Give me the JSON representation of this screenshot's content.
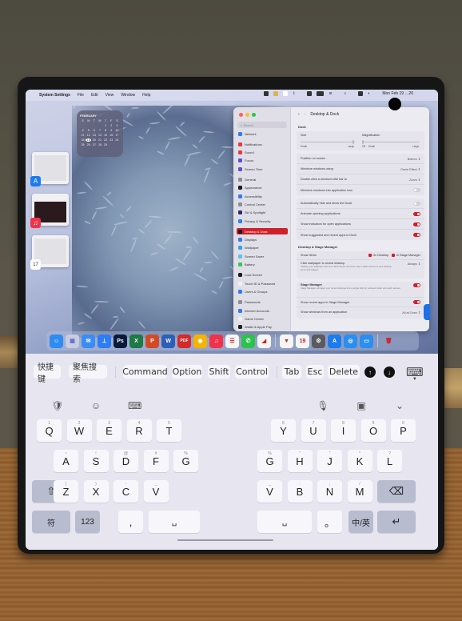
{
  "mac": {
    "menubar": {
      "apple_icon": "apple-icon",
      "app": "System Settings",
      "items": [
        "File",
        "Edit",
        "View",
        "Window",
        "Help"
      ],
      "clock": "Mon Feb 19 …26"
    },
    "calendar_widget": {
      "month": "FEBRUARY",
      "weekdays": [
        "S",
        "M",
        "T",
        "W",
        "T",
        "F",
        "S"
      ],
      "days": [
        "",
        "",
        "",
        "",
        "1",
        "2",
        "3",
        "4",
        "5",
        "6",
        "7",
        "8",
        "9",
        "10",
        "11",
        "12",
        "13",
        "14",
        "15",
        "16",
        "17",
        "18",
        "19",
        "20",
        "21",
        "22",
        "23",
        "24",
        "25",
        "26",
        "27",
        "28",
        "29"
      ],
      "today": "19"
    },
    "stage_manager": [
      {
        "app": "App Store",
        "icon": "app-store-icon",
        "color": "#1a7cf0",
        "glyph": "A"
      },
      {
        "app": "Music",
        "icon": "music-icon",
        "color": "#f0324a",
        "glyph": "♫"
      },
      {
        "app": "Calendar",
        "icon": "calendar-icon",
        "color": "#ffffff",
        "glyph": "17"
      }
    ],
    "settings": {
      "search_placeholder": "Search",
      "sidebar": [
        {
          "label": "Network",
          "color": "#2e7cf6"
        },
        {
          "label": "Notifications",
          "color": "#e8383d"
        },
        {
          "label": "Sound",
          "color": "#e8383d"
        },
        {
          "label": "Focus",
          "color": "#5b4fd6"
        },
        {
          "label": "Screen Time",
          "color": "#5b4fd6"
        },
        {
          "label": "General",
          "color": "#8e8e93"
        },
        {
          "label": "Appearance",
          "color": "#1c1c1e"
        },
        {
          "label": "Accessibility",
          "color": "#2e7cf6"
        },
        {
          "label": "Control Center",
          "color": "#8e8e93"
        },
        {
          "label": "Siri & Spotlight",
          "color": "#2a2a6e"
        },
        {
          "label": "Privacy & Security",
          "color": "#2e7cf6"
        },
        {
          "label": "Desktop & Dock",
          "color": "#1c1c1e",
          "selected": true
        },
        {
          "label": "Displays",
          "color": "#2e7cf6"
        },
        {
          "label": "Wallpaper",
          "color": "#33a4e8"
        },
        {
          "label": "Screen Saver",
          "color": "#5fc0e8"
        },
        {
          "label": "Battery",
          "color": "#34c759"
        },
        {
          "label": "Lock Screen",
          "color": "#1c1c1e"
        },
        {
          "label": "Touch ID & Password",
          "color": "#f0f0f0"
        },
        {
          "label": "Users & Groups",
          "color": "#2e7cf6"
        },
        {
          "label": "Passwords",
          "color": "#8e8e93"
        },
        {
          "label": "Internet Accounts",
          "color": "#2e7cf6"
        },
        {
          "label": "Game Center",
          "color": "#f0f0f0"
        },
        {
          "label": "Wallet & Apple Pay",
          "color": "#1c1c1e"
        }
      ],
      "page_title": "Desktop & Dock",
      "dock_section": "Dock",
      "size_label": "Size",
      "size_min": "Small",
      "size_max": "Large",
      "size_value": 0.98,
      "magnification_label": "Magnification",
      "mag_off": "Off",
      "mag_min": "Small",
      "mag_max": "Large",
      "magnification_value": 0.0,
      "dock_rows": [
        {
          "label": "Position on screen",
          "value": "Bottom ⇕"
        },
        {
          "label": "Minimize windows using",
          "value": "Genie Effect ⇕"
        },
        {
          "label": "Double-click a window's title bar to",
          "value": "Zoom ⇕"
        },
        {
          "label": "Minimize windows into application icon",
          "toggle": false
        }
      ],
      "dock_rows2": [
        {
          "label": "Automatically hide and show the Dock",
          "toggle": false
        },
        {
          "label": "Animate opening applications",
          "toggle": true
        },
        {
          "label": "Show indicators for open applications",
          "toggle": true
        },
        {
          "label": "Show suggested and recent apps in Dock",
          "toggle": true
        }
      ],
      "stage_section": "Desktop & Stage Manager",
      "show_items_label": "Show Items",
      "on_desktop": "On Desktop",
      "in_stage_manager": "In Stage Manager",
      "click_wallpaper_label": "Click wallpaper to reveal desktop",
      "click_wallpaper_desc": "Clicking your wallpaper will move all windows out of the way to allow access to your desktop items and widgets.",
      "click_wallpaper_value": "Always ⇕",
      "stage_manager_label": "Stage Manager",
      "stage_manager_desc": "Stage Manager arranges your recent windows into a single strip for reduced clutter and quick access.",
      "stage_manager_on": true,
      "show_recent_label": "Show recent apps in Stage Manager",
      "show_recent_on": true,
      "show_windows_label": "Show windows from an application",
      "show_windows_value": "All at Once ⇕"
    },
    "dock": [
      {
        "name": "finder",
        "color": "#2f8cf0",
        "glyph": "☺"
      },
      {
        "name": "launchpad",
        "color": "#c9cde0",
        "glyph": "▦"
      },
      {
        "name": "mail",
        "color": "#3a8df5",
        "glyph": "✉"
      },
      {
        "name": "keynote",
        "color": "#2e7cf6",
        "glyph": "⊥"
      },
      {
        "name": "photoshop",
        "color": "#0a1a3a",
        "glyph": "Ps"
      },
      {
        "name": "excel",
        "color": "#1d7a44",
        "glyph": "X"
      },
      {
        "name": "powerpoint",
        "color": "#d24a26",
        "glyph": "P"
      },
      {
        "name": "word",
        "color": "#2b5fb8",
        "glyph": "W"
      },
      {
        "name": "pdf",
        "color": "#d42a2a",
        "glyph": "PDF"
      },
      {
        "name": "chrome",
        "color": "#f4b400",
        "glyph": "◉"
      },
      {
        "name": "music",
        "color": "#f0324a",
        "glyph": "♫"
      },
      {
        "name": "reminders",
        "color": "#f5f5f5",
        "glyph": "☰"
      },
      {
        "name": "wechat",
        "color": "#2dc14e",
        "glyph": "✆"
      },
      {
        "name": "chart-app",
        "color": "#f5f5f5",
        "glyph": "◢"
      },
      {
        "name": "sep"
      },
      {
        "name": "direct-app",
        "color": "#f5f5f5",
        "glyph": "▼"
      },
      {
        "name": "calendar",
        "color": "#f5f5f5",
        "glyph": "19"
      },
      {
        "name": "system-settings",
        "color": "#5a5a60",
        "glyph": "⚙"
      },
      {
        "name": "app-store",
        "color": "#1a7cf0",
        "glyph": "A"
      },
      {
        "name": "safari",
        "color": "#2a8ff0",
        "glyph": "◎"
      },
      {
        "name": "screen-share",
        "color": "#2a8ff0",
        "glyph": "▭"
      },
      {
        "name": "sep"
      },
      {
        "name": "trash",
        "color": "#d8dce8",
        "glyph": "🗑"
      }
    ]
  },
  "keyboard": {
    "toolbar": [
      "快捷键",
      "聚焦搜索",
      "Command",
      "Option",
      "Shift",
      "Control",
      "Tab",
      "Esc",
      "Delete"
    ],
    "up_icon": "↑",
    "down_icon": "↓",
    "kbd_hide_icon": "⌨",
    "top_icons": {
      "left": [
        "🛡",
        "☺",
        "⌨"
      ],
      "right": [
        "🎙",
        "▣",
        "⌄"
      ]
    },
    "left_rows": [
      [
        {
          "k": "Q",
          "s": "1"
        },
        {
          "k": "W",
          "s": "2"
        },
        {
          "k": "E",
          "s": "3"
        },
        {
          "k": "R",
          "s": "4"
        },
        {
          "k": "T",
          "s": "5"
        }
      ],
      [
        {
          "k": "A",
          "s": "~"
        },
        {
          "k": "S",
          "s": "!"
        },
        {
          "k": "D",
          "s": "@"
        },
        {
          "k": "F",
          "s": "#"
        },
        {
          "k": "G",
          "s": "%"
        }
      ],
      [
        {
          "k": "⇧",
          "s": ""
        },
        {
          "k": "Z",
          "s": "("
        },
        {
          "k": "X",
          "s": ")"
        },
        {
          "k": "C",
          "s": "-"
        },
        {
          "k": "V",
          "s": "_"
        }
      ],
      [
        {
          "k": "符",
          "s": ""
        },
        {
          "k": "123",
          "s": ""
        },
        {
          "k": ",",
          "s": ""
        },
        {
          "k": "␣",
          "s": ""
        }
      ]
    ],
    "right_rows": [
      [
        {
          "k": "Y",
          "s": "6"
        },
        {
          "k": "U",
          "s": "7"
        },
        {
          "k": "I",
          "s": "8"
        },
        {
          "k": "O",
          "s": "9"
        },
        {
          "k": "P",
          "s": "0"
        }
      ],
      [
        {
          "k": "G",
          "s": "%"
        },
        {
          "k": "H",
          "s": "\""
        },
        {
          "k": "J",
          "s": "\""
        },
        {
          "k": "K",
          "s": "*"
        },
        {
          "k": "L",
          "s": "?"
        }
      ],
      [
        {
          "k": "V",
          "s": "_"
        },
        {
          "k": "B",
          "s": ":"
        },
        {
          "k": "N",
          "s": ";"
        },
        {
          "k": "M",
          "s": "/"
        },
        {
          "k": "⌫",
          "s": ""
        }
      ],
      [
        {
          "k": "␣",
          "s": ""
        },
        {
          "k": "。",
          "s": ""
        },
        {
          "k": "中/英",
          "s": ""
        },
        {
          "k": "↵",
          "s": ""
        }
      ]
    ]
  }
}
